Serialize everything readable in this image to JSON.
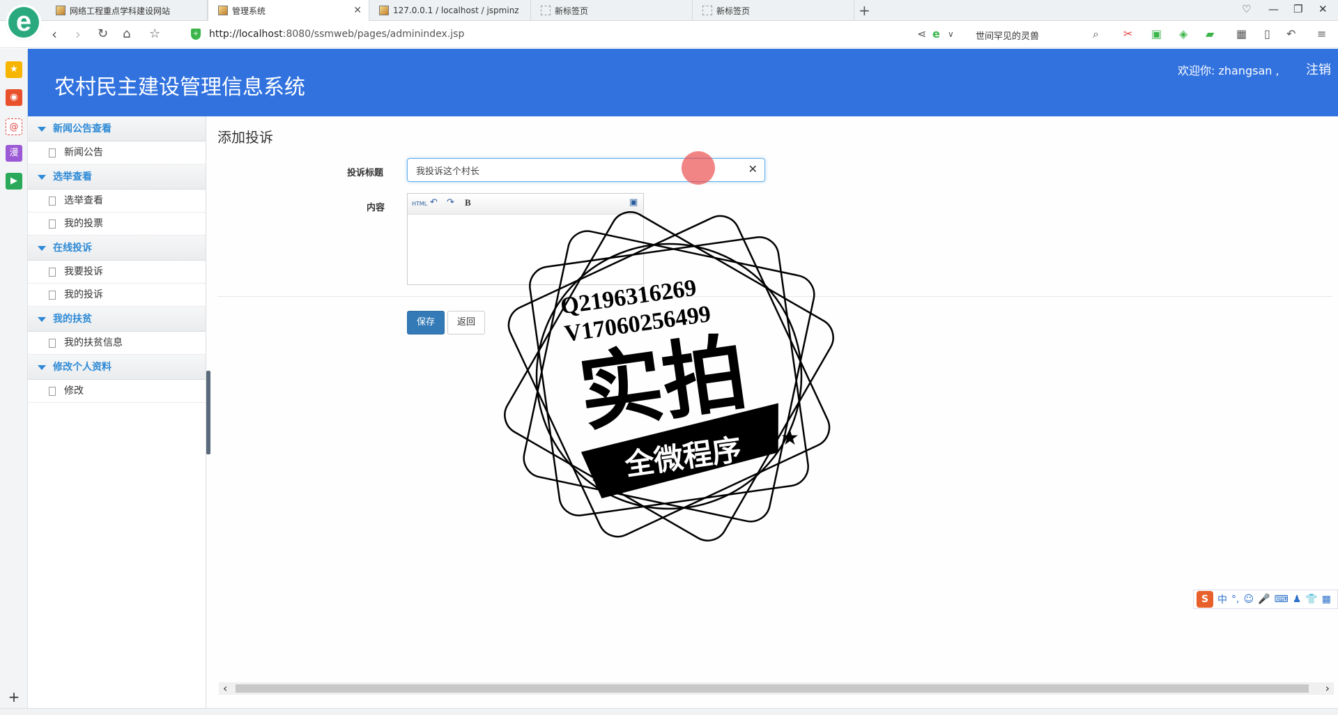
{
  "browser": {
    "tabs": [
      {
        "label": "网络工程重点学科建设网站",
        "active": false
      },
      {
        "label": "管理系统",
        "active": true
      },
      {
        "label": "127.0.0.1 / localhost / jspminz",
        "active": false
      },
      {
        "label": "新标签页",
        "active": false
      },
      {
        "label": "新标签页",
        "active": false
      }
    ],
    "url_host": "http://localhost",
    "url_rest": ":8080/ssmweb/pages/adminindex.jsp",
    "search_text": "世间罕见的灵兽"
  },
  "header": {
    "title": "农村民主建设管理信息系统",
    "welcome": "欢迎你: zhangsan ,",
    "logout": "注销"
  },
  "menu": [
    {
      "group": "新闻公告查看",
      "items": [
        "新闻公告"
      ]
    },
    {
      "group": "选举查看",
      "items": [
        "选举查看",
        "我的投票"
      ]
    },
    {
      "group": "在线投诉",
      "items": [
        "我要投诉",
        "我的投诉"
      ]
    },
    {
      "group": "我的扶贫",
      "items": [
        "我的扶贫信息"
      ]
    },
    {
      "group": "修改个人资料",
      "items": [
        "修改"
      ]
    }
  ],
  "form": {
    "page_title": "添加投诉",
    "title_label": "投诉标题",
    "title_value": "我投诉这个村长",
    "content_label": "内容",
    "editor_tools": [
      "HTML",
      "↶",
      "↷",
      "B"
    ],
    "save_label": "保存",
    "back_label": "返回"
  },
  "watermark": {
    "line1": "Q2196316269",
    "line2": "V17060256499",
    "main": "实拍",
    "banner": "全微程序"
  },
  "ime": {
    "logo": "S",
    "mode": "中"
  },
  "colors": {
    "header": "#3172df",
    "menu_accent": "#2e8ad6",
    "save_button": "#337ab7"
  }
}
